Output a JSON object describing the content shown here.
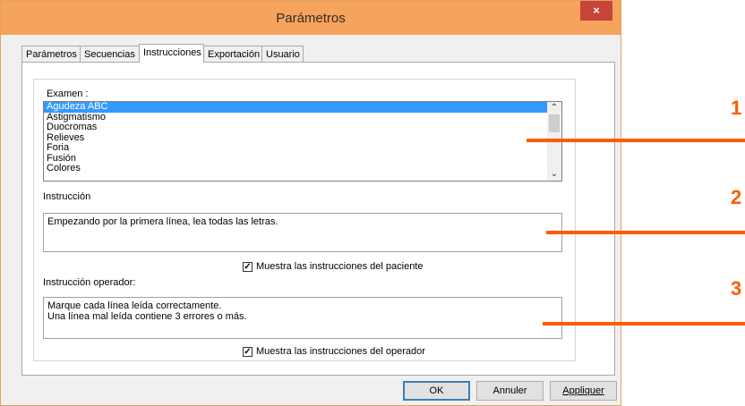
{
  "window": {
    "title": "Parámetros",
    "close_label": "×"
  },
  "tabs": [
    {
      "label": "Parámetros"
    },
    {
      "label": "Secuencias"
    },
    {
      "label": "Instrucciones"
    },
    {
      "label": "Exportación"
    },
    {
      "label": "Usuario"
    }
  ],
  "active_tab": "Instrucciones",
  "exam": {
    "label": "Examen :",
    "items": [
      "Agudeza ABC",
      "Astigmatismo",
      "Duocromas",
      "Relieves",
      "Foria",
      "Fusión",
      "Colores"
    ],
    "selected": "Agudeza ABC"
  },
  "instruction": {
    "label": "Instrucción",
    "text": "Empezando por la primera línea, lea todas las letras.",
    "checkbox_label": "Muestra las instrucciones del paciente",
    "checked": true
  },
  "operator_instruction": {
    "label": "Instrucción operador:",
    "text": "Marque cada línea leída correctamente.\nUna línea mal leída contiene 3 errores o más.",
    "checkbox_label": "Muestra las instrucciones del operador",
    "checked": true
  },
  "buttons": {
    "ok": "OK",
    "cancel": "Annuler",
    "apply": "Appliquer"
  },
  "callouts": [
    "1",
    "2",
    "3"
  ],
  "colors": {
    "titlebar": "#f5a35d",
    "close": "#c7443a",
    "callout": "#ff5a00",
    "selection": "#3399ff"
  },
  "icons": {
    "close": "close-icon",
    "scroll_up": "chevron-up-icon",
    "scroll_down": "chevron-down-icon",
    "check": "check-icon"
  }
}
